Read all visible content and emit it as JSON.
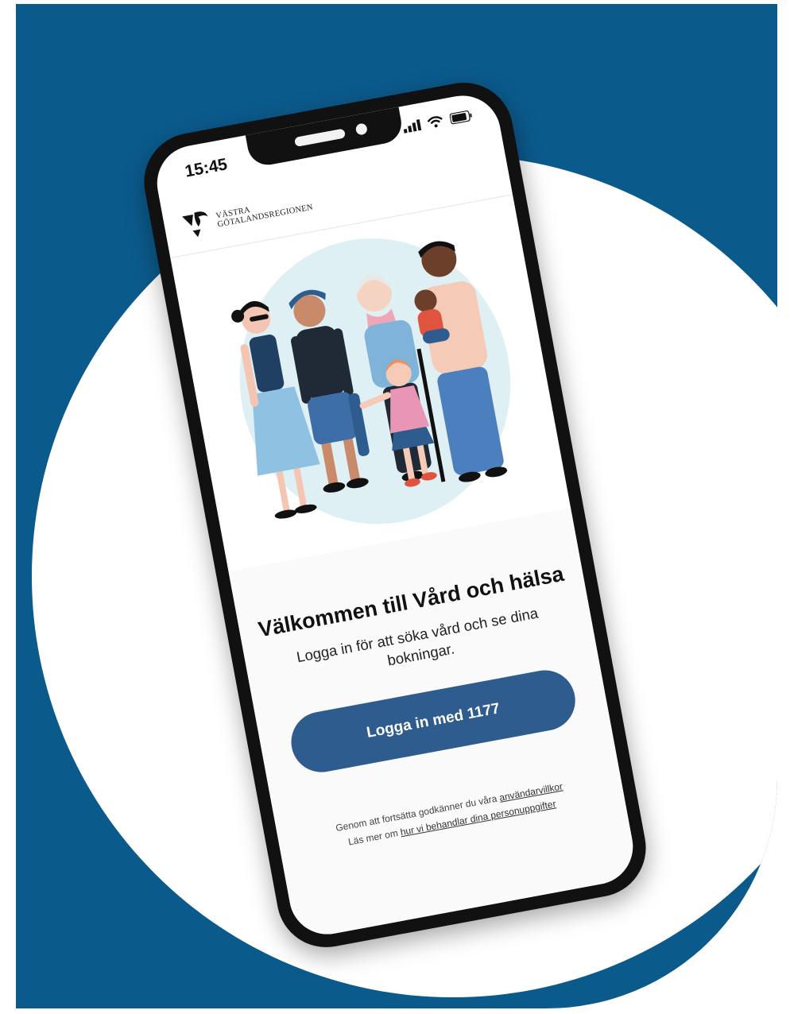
{
  "status_bar": {
    "time": "15:45",
    "icons": [
      "signal-icon",
      "wifi-icon",
      "battery-icon"
    ]
  },
  "header": {
    "logo_line1": "VÄSTRA",
    "logo_line2": "GÖTALANDSREGIONEN"
  },
  "illustration": {
    "subject": "group-of-people-illustration"
  },
  "welcome": {
    "title": "Välkommen till Vård och hälsa",
    "subtitle": "Logga in för att söka vård och se dina bokningar.",
    "login_button": "Logga in med 1177"
  },
  "footer": {
    "terms_prefix": "Genom att fortsätta godkänner du våra",
    "terms_link": "användarvillkor",
    "privacy_prefix": "Läs mer om",
    "privacy_link": "hur vi behandlar dina personuppgifter"
  },
  "colors": {
    "background_blue": "#0b5a8c",
    "button_blue": "#2e5c8e",
    "illustration_bg": "#dff0f5"
  }
}
